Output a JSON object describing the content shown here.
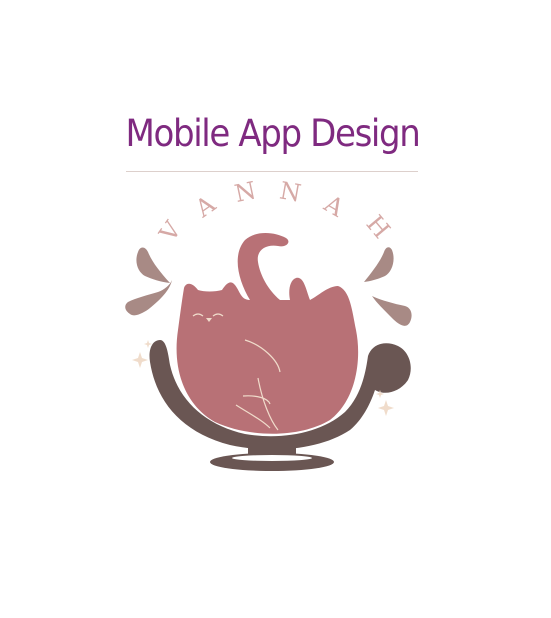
{
  "title": "Mobile App Design",
  "logo": {
    "text": "VANNAH",
    "colors": {
      "title": "#7f2a80",
      "cat": "#b87176",
      "bowl": "#6a5653",
      "splash": "#a88a85",
      "sparkle": "#f0dccb",
      "lettering": "#d6a9a6"
    }
  }
}
